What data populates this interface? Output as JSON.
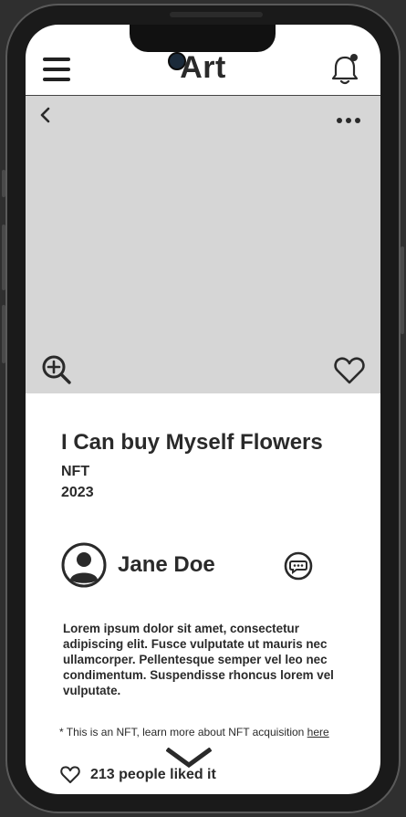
{
  "header": {
    "title": "Art",
    "menu_icon": "hamburger-menu-icon",
    "notification_icon": "bell-icon"
  },
  "hero": {
    "back_icon": "chevron-left-icon",
    "more_icon": "ellipsis-icon",
    "zoom_icon": "zoom-in-icon",
    "favorite_icon": "heart-icon"
  },
  "artwork": {
    "title": "I Can buy Myself Flowers",
    "type": "NFT",
    "year": "2023"
  },
  "artist": {
    "name": "Jane Doe",
    "avatar_icon": "user-avatar-icon",
    "message_icon": "chat-bubble-icon"
  },
  "description": "Lorem ipsum dolor sit amet, consectetur adipiscing elit. Fusce vulputate ut mauris nec ullamcorper. Pellentesque semper vel leo nec condimentum. Suspendisse rhoncus lorem vel vulputate.",
  "footnote": {
    "text": "* This is an NFT, learn more about NFT acquisition ",
    "link": "here"
  },
  "likes": {
    "text": "213 people liked it",
    "icon": "heart-outline-icon"
  },
  "scroll_icon": "chevron-down-icon",
  "colors": {
    "hero_background": "#d6d6d6",
    "text": "#2a2a2a",
    "device_frame": "#1a1a1a"
  }
}
